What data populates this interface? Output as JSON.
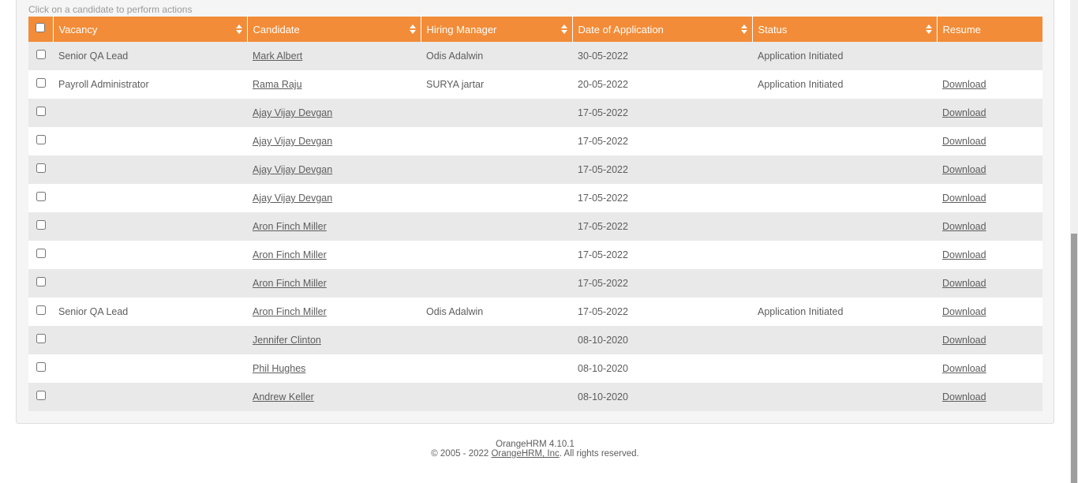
{
  "hint": "Click on a candidate to perform actions",
  "columns": {
    "vacancy": "Vacancy",
    "candidate": "Candidate",
    "hiring_manager": "Hiring Manager",
    "date": "Date of Application",
    "status": "Status",
    "resume": "Resume"
  },
  "rows": [
    {
      "vacancy": "Senior QA Lead",
      "candidate": "Mark Albert",
      "hiring_manager": "Odis Adalwin",
      "date": "30-05-2022",
      "status": "Application Initiated",
      "resume": ""
    },
    {
      "vacancy": "Payroll Administrator",
      "candidate": "Rama Raju",
      "hiring_manager": "SURYA jartar",
      "date": "20-05-2022",
      "status": "Application Initiated",
      "resume": "Download"
    },
    {
      "vacancy": "",
      "candidate": "Ajay Vijay Devgan",
      "hiring_manager": "",
      "date": "17-05-2022",
      "status": "",
      "resume": "Download"
    },
    {
      "vacancy": "",
      "candidate": "Ajay Vijay Devgan",
      "hiring_manager": "",
      "date": "17-05-2022",
      "status": "",
      "resume": "Download"
    },
    {
      "vacancy": "",
      "candidate": "Ajay Vijay Devgan",
      "hiring_manager": "",
      "date": "17-05-2022",
      "status": "",
      "resume": "Download"
    },
    {
      "vacancy": "",
      "candidate": "Ajay Vijay Devgan",
      "hiring_manager": "",
      "date": "17-05-2022",
      "status": "",
      "resume": "Download"
    },
    {
      "vacancy": "",
      "candidate": "Aron Finch Miller",
      "hiring_manager": "",
      "date": "17-05-2022",
      "status": "",
      "resume": "Download"
    },
    {
      "vacancy": "",
      "candidate": "Aron Finch Miller",
      "hiring_manager": "",
      "date": "17-05-2022",
      "status": "",
      "resume": "Download"
    },
    {
      "vacancy": "",
      "candidate": "Aron Finch Miller",
      "hiring_manager": "",
      "date": "17-05-2022",
      "status": "",
      "resume": "Download"
    },
    {
      "vacancy": "Senior QA Lead",
      "candidate": "Aron Finch Miller",
      "hiring_manager": "Odis Adalwin",
      "date": "17-05-2022",
      "status": "Application Initiated",
      "resume": "Download"
    },
    {
      "vacancy": "",
      "candidate": "Jennifer Clinton",
      "hiring_manager": "",
      "date": "08-10-2020",
      "status": "",
      "resume": "Download"
    },
    {
      "vacancy": "",
      "candidate": "Phil Hughes",
      "hiring_manager": "",
      "date": "08-10-2020",
      "status": "",
      "resume": "Download"
    },
    {
      "vacancy": "",
      "candidate": "Andrew Keller",
      "hiring_manager": "",
      "date": "08-10-2020",
      "status": "",
      "resume": "Download"
    }
  ],
  "footer": {
    "version": "OrangeHRM 4.10.1",
    "copyright_prefix": "© 2005 - 2022 ",
    "company_link": "OrangeHRM, Inc",
    "copyright_suffix": ". All rights reserved."
  },
  "colors": {
    "header_bg": "#f28c38",
    "row_alt_bg": "#e9e9e9"
  }
}
